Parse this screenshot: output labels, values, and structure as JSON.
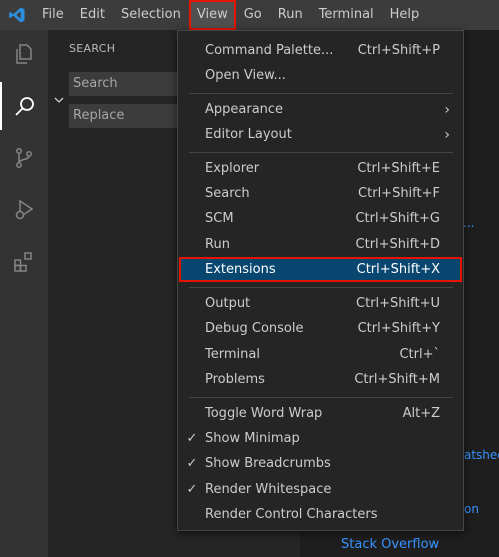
{
  "menubar": {
    "items": [
      "File",
      "Edit",
      "Selection",
      "View",
      "Go",
      "Run",
      "Terminal",
      "Help"
    ],
    "active": "View"
  },
  "sidebar": {
    "title": "SEARCH",
    "search_placeholder": "Search",
    "replace_placeholder": "Replace"
  },
  "view_menu": {
    "groups": [
      [
        {
          "label": "Command Palette...",
          "shortcut": "Ctrl+Shift+P"
        },
        {
          "label": "Open View...",
          "shortcut": ""
        }
      ],
      [
        {
          "label": "Appearance",
          "submenu": true
        },
        {
          "label": "Editor Layout",
          "submenu": true
        }
      ],
      [
        {
          "label": "Explorer",
          "shortcut": "Ctrl+Shift+E"
        },
        {
          "label": "Search",
          "shortcut": "Ctrl+Shift+F"
        },
        {
          "label": "SCM",
          "shortcut": "Ctrl+Shift+G"
        },
        {
          "label": "Run",
          "shortcut": "Ctrl+Shift+D"
        },
        {
          "label": "Extensions",
          "shortcut": "Ctrl+Shift+X",
          "highlighted": true
        }
      ],
      [
        {
          "label": "Output",
          "shortcut": "Ctrl+Shift+U"
        },
        {
          "label": "Debug Console",
          "shortcut": "Ctrl+Shift+Y"
        },
        {
          "label": "Terminal",
          "shortcut": "Ctrl+`"
        },
        {
          "label": "Problems",
          "shortcut": "Ctrl+Shift+M"
        }
      ],
      [
        {
          "label": "Toggle Word Wrap",
          "shortcut": "Alt+Z",
          "checked": false
        },
        {
          "label": "Show Minimap",
          "shortcut": "",
          "checked": true
        },
        {
          "label": "Show Breadcrumbs",
          "shortcut": "",
          "checked": true
        },
        {
          "label": "Render Whitespace",
          "shortcut": "",
          "checked": true
        },
        {
          "label": "Render Control Characters",
          "shortcut": "",
          "checked": false
        }
      ]
    ]
  },
  "background_links": {
    "ellipsis": "...",
    "cheatsheet_fragment": "atsheet",
    "on_fragment": "on",
    "stack_overflow": "Stack Overflow"
  },
  "colors": {
    "accent_highlight": "#094771",
    "focus_outline": "#e51400",
    "link": "#3794ff"
  }
}
